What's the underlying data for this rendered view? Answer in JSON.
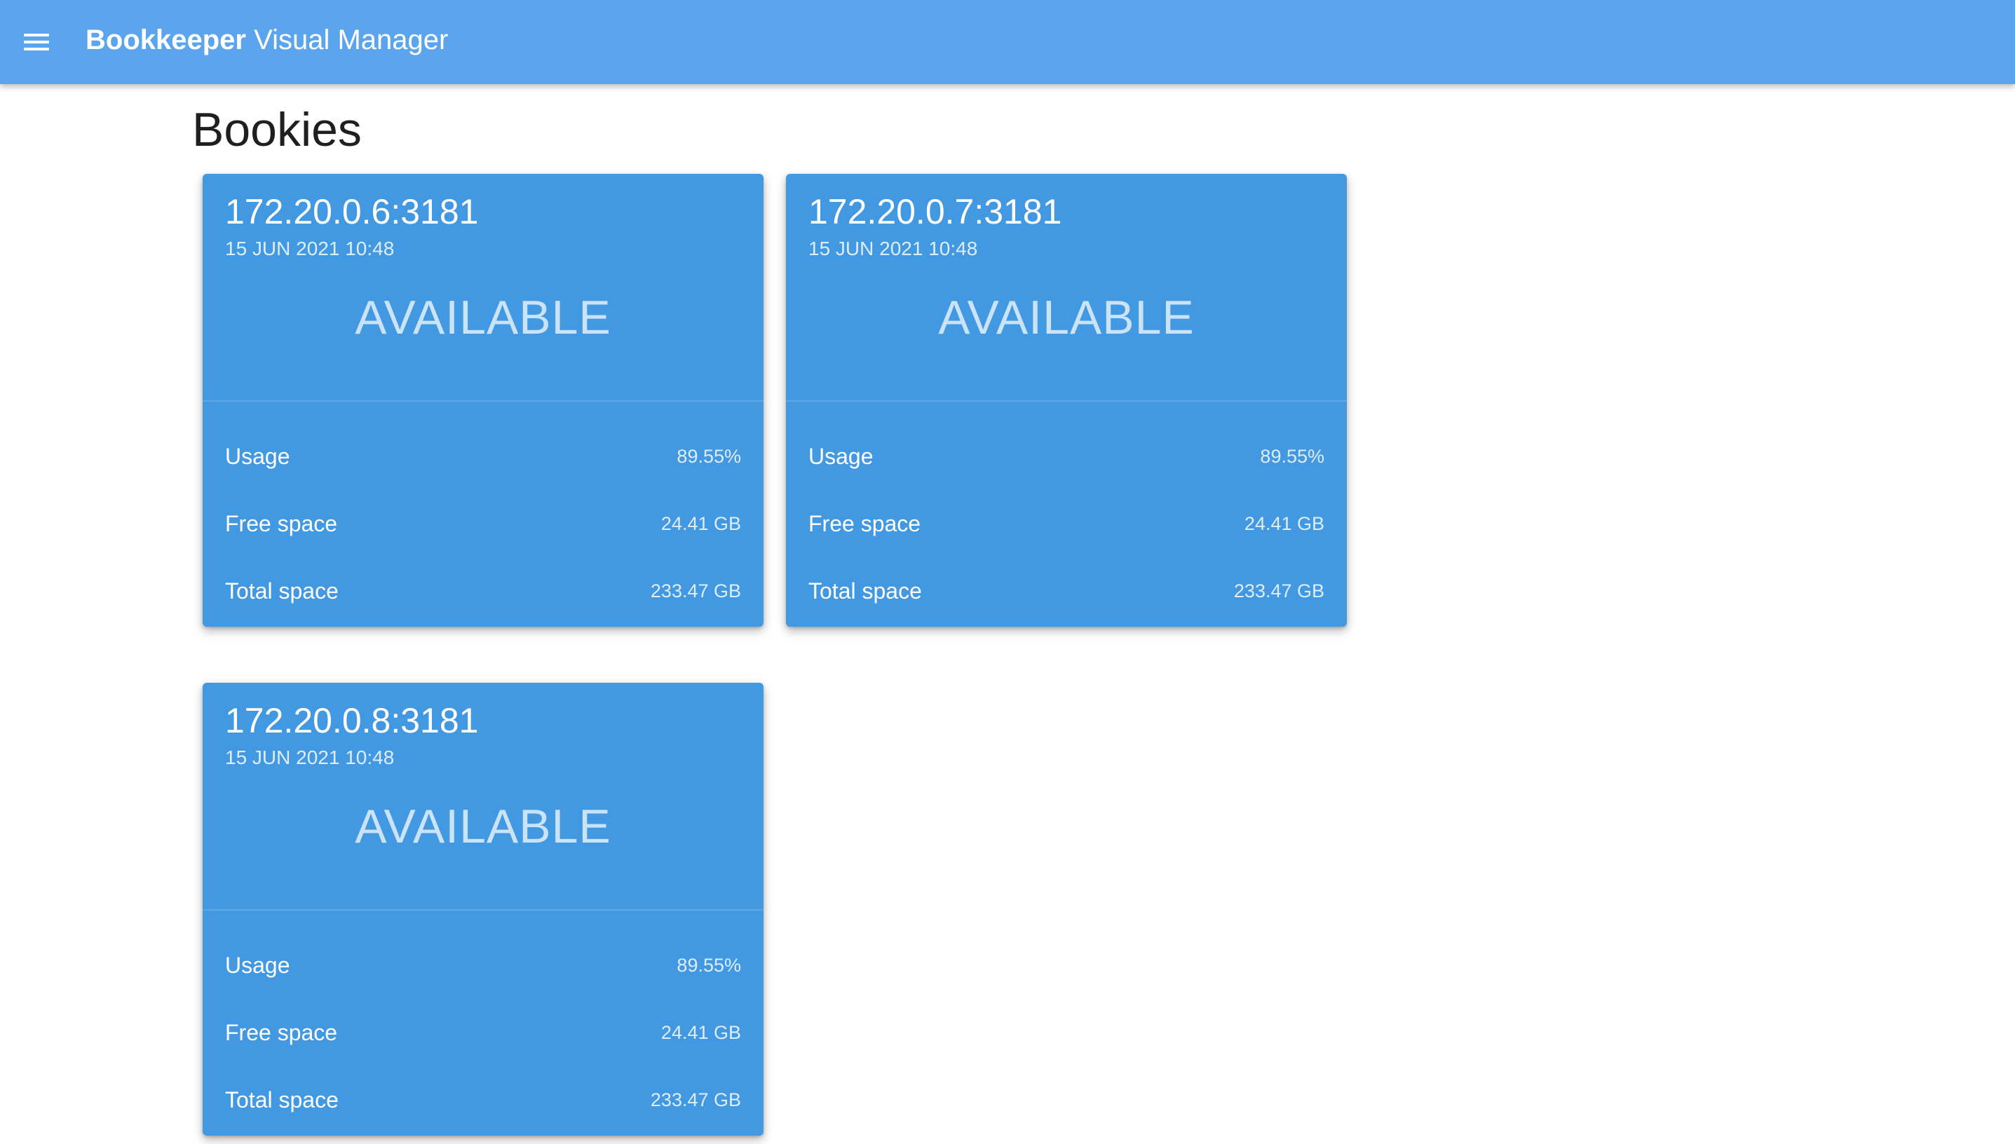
{
  "appbar": {
    "title_bold": "Bookkeeper",
    "title_rest": "Visual Manager",
    "menu_icon": "hamburger-menu-icon",
    "color": "#5ba4ee"
  },
  "page": {
    "title": "Bookies"
  },
  "theme": {
    "card_color": "#4299e1"
  },
  "bookies": [
    {
      "host": "172.20.0.6:3181",
      "timestamp": "15 JUN 2021 10:48",
      "status": "AVAILABLE",
      "stats": [
        {
          "label": "Usage",
          "value": "89.55%"
        },
        {
          "label": "Free space",
          "value": "24.41 GB"
        },
        {
          "label": "Total space",
          "value": "233.47 GB"
        }
      ]
    },
    {
      "host": "172.20.0.7:3181",
      "timestamp": "15 JUN 2021 10:48",
      "status": "AVAILABLE",
      "stats": [
        {
          "label": "Usage",
          "value": "89.55%"
        },
        {
          "label": "Free space",
          "value": "24.41 GB"
        },
        {
          "label": "Total space",
          "value": "233.47 GB"
        }
      ]
    },
    {
      "host": "172.20.0.8:3181",
      "timestamp": "15 JUN 2021 10:48",
      "status": "AVAILABLE",
      "stats": [
        {
          "label": "Usage",
          "value": "89.55%"
        },
        {
          "label": "Free space",
          "value": "24.41 GB"
        },
        {
          "label": "Total space",
          "value": "233.47 GB"
        }
      ]
    }
  ]
}
